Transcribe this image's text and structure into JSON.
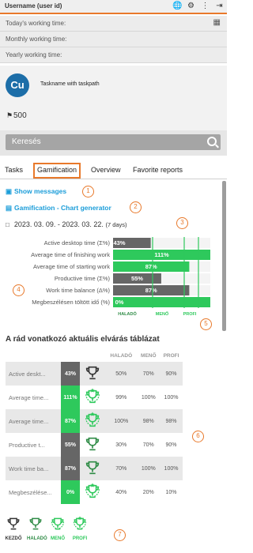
{
  "header": {
    "username": "Username (user id)",
    "icons": [
      "globe-icon",
      "gear-icon",
      "more-vertical-icon",
      "logout-icon"
    ]
  },
  "working_time": {
    "today": "Today's working time:",
    "monthly": "Monthly working time:",
    "yearly": "Yearly working time:",
    "chart_icon": "bar-chart-person-icon"
  },
  "task": {
    "avatar_initials": "Cu",
    "name": "Taskname with taskpath",
    "flag_value": "500"
  },
  "search": {
    "placeholder": "Keresés"
  },
  "tabs": [
    {
      "label": "Tasks",
      "active": false
    },
    {
      "label": "Gamification",
      "active": true
    },
    {
      "label": "Overview",
      "active": false
    },
    {
      "label": "Favorite reports",
      "active": false
    }
  ],
  "links": {
    "show_messages": "Show messages",
    "chart_generator": "Gamification - Chart generator"
  },
  "date_range": {
    "text": "2023.  03.  09.  -  2023.  03.  22.",
    "days": "(7 days)"
  },
  "callouts": [
    "1",
    "2",
    "3",
    "4",
    "5",
    "6",
    "7"
  ],
  "colors": {
    "accent": "#e8792b",
    "link": "#1b9dd9",
    "green": "#2ec95c",
    "dark_gray": "#666666",
    "avatar": "#1d6ea8"
  },
  "chart_data": {
    "type": "bar",
    "orientation": "horizontal",
    "categories": [
      "Active desktop time (Σ%)",
      "Average time of finishing work",
      "Average time of starting work",
      "Productive time (Σ%)",
      "Work time balance (Δ%)",
      "Megbeszélésen töltött idő (%)"
    ],
    "values": [
      43,
      111,
      87,
      55,
      87,
      0
    ],
    "labels": [
      "43%",
      "111%",
      "87%",
      "55%",
      "87%",
      "0%"
    ],
    "bar_level": [
      "kezdo",
      "profi",
      "profi",
      "halado",
      "halado",
      "profi"
    ],
    "zones": [
      "HALADÓ",
      "MENŐ",
      "PROFI"
    ],
    "legend": "bottom"
  },
  "expectation_table": {
    "title": "A rád vonatkozó aktuális elvárás táblázat",
    "headers": [
      "HALADÓ",
      "MENŐ",
      "PROFI"
    ],
    "rows": [
      {
        "name": "Active deskt...",
        "value": "43%",
        "level": "kezdo",
        "halado": "50%",
        "meno": "70%",
        "profi": "90%"
      },
      {
        "name": "Average time...",
        "value": "111%",
        "level": "profi",
        "halado": "99%",
        "meno": "100%",
        "profi": "100%"
      },
      {
        "name": "Average time...",
        "value": "87%",
        "level": "profi",
        "halado": "100%",
        "meno": "98%",
        "profi": "98%"
      },
      {
        "name": "Productive t...",
        "value": "55%",
        "level": "halado",
        "halado": "30%",
        "meno": "70%",
        "profi": "90%"
      },
      {
        "name": "Work time ba...",
        "value": "87%",
        "level": "halado",
        "halado": "70%",
        "meno": "100%",
        "profi": "100%"
      },
      {
        "name": "Megbeszélése...",
        "value": "0%",
        "level": "profi",
        "halado": "40%",
        "meno": "20%",
        "profi": "10%"
      }
    ]
  },
  "legend": [
    {
      "label": "KEZDŐ",
      "color": "#333333"
    },
    {
      "label": "HALADÓ",
      "color": "#2e8b45"
    },
    {
      "label": "MENŐ",
      "color": "#2ec95c"
    },
    {
      "label": "PROFI",
      "color": "#2ec95c"
    }
  ]
}
